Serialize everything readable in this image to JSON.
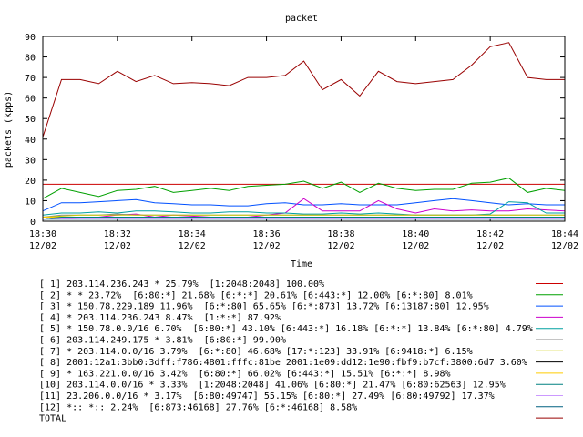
{
  "chart_data": {
    "type": "line",
    "title": "packet",
    "xlabel": "Time",
    "ylabel": "packets (kpps)",
    "ylim": [
      0,
      90
    ],
    "yticks": [
      "0",
      "10",
      "20",
      "30",
      "40",
      "50",
      "60",
      "70",
      "80",
      "90"
    ],
    "xlim": [
      "18:30",
      "18:44"
    ],
    "xticks": [
      {
        "time": "18:30",
        "date": "12/02"
      },
      {
        "time": "18:32",
        "date": "12/02"
      },
      {
        "time": "18:34",
        "date": "12/02"
      },
      {
        "time": "18:36",
        "date": "12/02"
      },
      {
        "time": "18:38",
        "date": "12/02"
      },
      {
        "time": "18:40",
        "date": "12/02"
      },
      {
        "time": "18:42",
        "date": "12/02"
      },
      {
        "time": "18:44",
        "date": "12/02"
      }
    ],
    "grid": false,
    "legend_position": "below",
    "x": [
      "18:30:00",
      "18:30:30",
      "18:31:00",
      "18:31:30",
      "18:32:00",
      "18:32:30",
      "18:33:00",
      "18:33:30",
      "18:34:00",
      "18:34:30",
      "18:35:00",
      "18:35:30",
      "18:36:00",
      "18:36:30",
      "18:37:00",
      "18:37:30",
      "18:38:00",
      "18:38:30",
      "18:39:00",
      "18:39:30",
      "18:40:00",
      "18:40:30",
      "18:41:00",
      "18:41:30",
      "18:42:00",
      "18:42:30",
      "18:43:00",
      "18:43:30",
      "18:44:00"
    ],
    "series": [
      {
        "name": "[ 1] 203.114.236.243 * 25.79%  [1:2048:2048] 100.00%",
        "color": "#cc0000",
        "values": [
          18,
          18,
          18,
          18,
          18,
          18,
          18,
          18,
          18,
          18,
          18,
          18,
          18,
          18,
          18,
          18,
          18,
          18,
          18,
          18,
          18,
          18,
          18,
          18,
          18,
          18,
          18,
          18,
          18
        ]
      },
      {
        "name": "[ 2] * * 23.72%  [6:80:*] 21.68% [6:*:*] 20.61% [6:443:*] 12.00% [6:*:80] 8.01%",
        "color": "#00a000",
        "values": [
          11,
          16,
          14,
          12,
          15,
          15.5,
          17,
          14,
          15,
          16,
          15,
          17,
          17.5,
          18,
          19.5,
          16,
          19,
          14,
          18.5,
          16,
          15,
          15.5,
          15.5,
          18.5,
          19,
          21,
          14,
          16,
          15
        ]
      },
      {
        "name": "[ 3] * 150.78.229.189 11.96%  [6:*:80] 65.65% [6:*:873] 13.72% [6:13187:80] 12.95%",
        "color": "#0050ff",
        "values": [
          5,
          9,
          9,
          9.5,
          10,
          10.5,
          9,
          8.5,
          8,
          8,
          7.5,
          7.5,
          8.5,
          9,
          8,
          8,
          8.5,
          8,
          8,
          8,
          9,
          10,
          11,
          10,
          9,
          8,
          8.5,
          8,
          8
        ]
      },
      {
        "name": "[ 4] * 203.114.236.243 8.47%  [1:*:*] 87.92%",
        "color": "#cc00cc",
        "values": [
          1,
          1.5,
          2,
          2,
          3,
          3.5,
          2,
          3,
          2.5,
          2,
          2,
          2,
          3,
          4,
          11,
          5,
          5,
          5,
          10,
          6,
          4,
          6,
          5,
          5.5,
          5,
          5,
          6,
          5.5,
          5
        ]
      },
      {
        "name": "[ 5] * 150.78.0.0/16 6.70%  [6:80:*] 43.10% [6:443:*] 16.18% [6:*:*] 13.84% [6:*:80] 4.79%",
        "color": "#00a0a0",
        "values": [
          3,
          4,
          4,
          4.5,
          4,
          5,
          5,
          4.5,
          4,
          4,
          4.5,
          4.5,
          4,
          4,
          3.5,
          3.5,
          4,
          3.5,
          4,
          3.5,
          3,
          3,
          3,
          3,
          3.5,
          9.5,
          9,
          4,
          4
        ]
      },
      {
        "name": "[ 6] 203.114.249.175 * 3.81%  [6:80:*] 99.90%",
        "color": "#888888",
        "values": [
          2,
          3,
          3,
          3,
          3.5,
          3,
          3,
          3,
          3,
          3,
          3,
          3,
          3,
          3,
          3,
          3,
          3,
          3,
          3,
          3,
          3,
          3,
          3,
          3,
          3,
          3,
          3,
          3,
          3
        ]
      },
      {
        "name": "[ 7] * 203.114.0.0/16 3.79%  [6:*:80] 46.68% [17:*:123] 33.91% [6:9418:*] 6.15%",
        "color": "#cccc00",
        "values": [
          2,
          2.5,
          3,
          3,
          3,
          3,
          3,
          3,
          3,
          3,
          3,
          3,
          3,
          3,
          3,
          3,
          3,
          3,
          3,
          3,
          3,
          3,
          3,
          3,
          3,
          3,
          3,
          3,
          3
        ]
      },
      {
        "name": "[ 8] 2001:12a1:3bb0:3dff:f786:4801:fffc:81be 2001:1e09:dd12:1e90:fbf9:b7cf:3800:6d7 3.60%",
        "color": "#000000",
        "values": [
          1,
          2,
          2,
          2,
          2,
          2,
          2,
          2,
          2,
          2,
          2,
          2,
          2,
          2,
          2,
          2,
          2,
          2,
          2,
          2,
          2,
          2,
          2,
          2,
          2,
          2,
          2,
          2,
          2
        ]
      },
      {
        "name": "[ 9] * 163.221.0.0/16 3.42%  [6:80:*] 66.02% [6:443:*] 15.51% [6:*:*] 8.98%",
        "color": "#ffcc00",
        "values": [
          2,
          2,
          2,
          2,
          2,
          2,
          2,
          2,
          2,
          2,
          2,
          2,
          2,
          2,
          2,
          2,
          2,
          2,
          2,
          2,
          2,
          2,
          2,
          2,
          2,
          2,
          2,
          2,
          2
        ]
      },
      {
        "name": "[10] 203.114.0.0/16 * 3.33%  [1:2048:2048] 41.06% [6:80:*] 21.47% [6:80:62563] 12.95%",
        "color": "#008080",
        "values": [
          1,
          2,
          2,
          2,
          2,
          2,
          2,
          2,
          2,
          2,
          2,
          2,
          2,
          2,
          2,
          2,
          2,
          2,
          2,
          2,
          2,
          2,
          2,
          2,
          2,
          2,
          2,
          2,
          2
        ]
      },
      {
        "name": "[11] 23.206.0.0/16 * 3.17%  [6:80:49747] 55.15% [6:80:*] 27.49% [6:80:49792] 17.37%",
        "color": "#cc99ff",
        "values": [
          1,
          1.5,
          1.5,
          1.5,
          1.5,
          1.5,
          1.5,
          1.5,
          1.5,
          1.5,
          1.5,
          1.5,
          1.5,
          1.5,
          1.5,
          1.5,
          1.5,
          1.5,
          1.5,
          1.5,
          1.5,
          1.5,
          1.5,
          1.5,
          1.5,
          1.5,
          1.5,
          1.5,
          1.5
        ]
      },
      {
        "name": "[12] *:: *:: 2.24%  [6:873:46168] 27.76% [6:*:46168] 8.58%",
        "color": "#006080",
        "values": [
          1,
          1,
          1,
          1,
          1,
          1,
          1,
          1,
          1,
          1,
          1,
          1,
          1,
          1,
          1,
          1,
          1,
          1,
          1,
          1,
          1,
          1,
          1,
          1,
          1,
          1,
          1,
          1,
          1
        ]
      },
      {
        "name": "TOTAL",
        "color": "#990000",
        "values": [
          41,
          69,
          69,
          67,
          73,
          68,
          71,
          67,
          67.5,
          67,
          66,
          70,
          70,
          71,
          78,
          64,
          69,
          61,
          73,
          68,
          67,
          68,
          69,
          76,
          85,
          87,
          70,
          69,
          69
        ]
      }
    ]
  }
}
